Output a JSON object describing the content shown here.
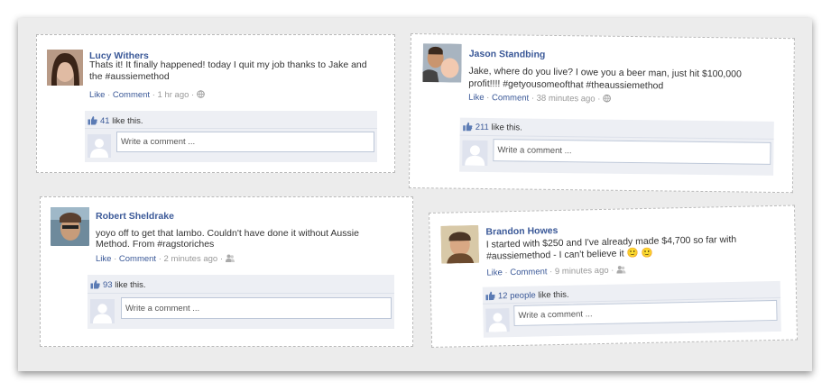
{
  "posts": [
    {
      "name": "Lucy Withers",
      "text_line1": "Thats it! It finally happened! today I quit my job thanks to Jake and",
      "text_line2": "the #aussiemethod",
      "like": "Like",
      "comment": "Comment",
      "time": "1 hr ago",
      "likes_count": "41",
      "likes_suffix": "like this.",
      "placeholder": "Write a comment ..."
    },
    {
      "name": "Jason Standbing",
      "text_line1": "Jake, where do you live? I owe you a beer man, just hit $100,000",
      "text_line2": "profit!!!! #getyousomeofthat #theaussiemethod",
      "like": "Like",
      "comment": "Comment",
      "time": "38 minutes ago",
      "likes_count": "211",
      "likes_suffix": "like this.",
      "placeholder": "Write a comment ..."
    },
    {
      "name": "Robert Sheldrake",
      "text_line1": "yoyo off to get that lambo. Couldn't have done it without Aussie",
      "text_line2": "Method. From #ragstoriches",
      "like": "Like",
      "comment": "Comment",
      "time": "2 minutes ago",
      "likes_count": "93",
      "likes_suffix": "like this.",
      "placeholder": "Write a comment ..."
    },
    {
      "name": "Brandon Howes",
      "text_line1": "I started with $250 and I've already made $4,700 so far with",
      "text_line2": "#aussiemethod - I can't believe it 🙂 🙂",
      "like": "Like",
      "comment": "Comment",
      "time": "9 minutes ago",
      "likes_count": "12 people",
      "likes_suffix": "like this.",
      "placeholder": "Write a comment ..."
    }
  ],
  "separator": "·",
  "icons": {
    "globe": "globe-icon",
    "friends": "friends-icon",
    "thumb": "thumbs-up-icon",
    "silhouette": "default-avatar-icon"
  },
  "colors": {
    "link": "#3b5998",
    "box": "#edeff4",
    "frame": "#ececec"
  }
}
